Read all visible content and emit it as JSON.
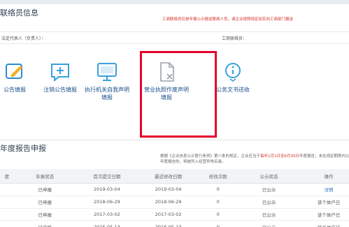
{
  "section_contact": "联络员信息",
  "notice": "工商联络员仅是年报公示报送联络人员，请企业按照规定如实向工商部门报送",
  "info": {
    "legal_rep_label": "法定代表人（负责人）：",
    "liaison_label": "工商联络员："
  },
  "actions": [
    {
      "label": "公告填报",
      "icon": "edit-icon"
    },
    {
      "label": "注销公告填报",
      "icon": "cancel-notice-icon"
    },
    {
      "label": "执行机关自我声明填报",
      "icon": "monitor-icon"
    },
    {
      "label": "营业执照作废声明填报",
      "icon": "document-cancel-icon"
    },
    {
      "label": "公务文书送收",
      "icon": "info-icon"
    }
  ],
  "section_report": "年度报告申报",
  "law_note": {
    "prefix": "根据《企业信息公示暂行条例》第八条的规定，企业应当于",
    "highlight": "每年1月1日至6月30日",
    "suffix": "年度报告；未在规定期限内公示年度报告的，将被列入经营异常名录。"
  },
  "table": {
    "headers": [
      "度",
      "年报状态",
      "首次提交日期",
      "最近修改日期",
      "修改次数",
      "公示状态",
      "操作"
    ],
    "rows": [
      [
        "",
        "已申报",
        "2019-03-04",
        "2019-03-04",
        "0",
        "已公示",
        "详情"
      ],
      [
        "",
        "已申报",
        "2018-06-29",
        "2018-06-29",
        "0",
        "已公示",
        "该个体户已"
      ],
      [
        "",
        "已申报",
        "2017-03-02",
        "2017-03-02",
        "0",
        "已公示",
        "该个体户已"
      ],
      [
        "",
        "已申报",
        "2016-05-13",
        "2016-05-13",
        "0",
        "已公示",
        "该个体户已"
      ]
    ]
  },
  "colors": {
    "accent": "#1b4f8a",
    "highlight_border": "#e4002b",
    "notice": "#d3322a"
  }
}
